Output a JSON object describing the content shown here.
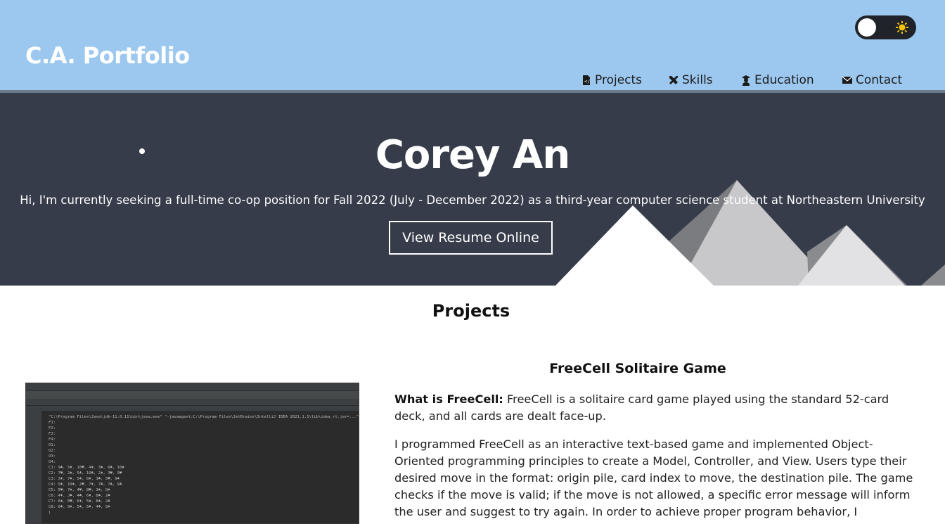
{
  "header": {
    "brand": "C.A. Portfolio",
    "nav": [
      {
        "label": "Projects",
        "icon": "code-file-icon"
      },
      {
        "label": "Skills",
        "icon": "tools-icon"
      },
      {
        "label": "Education",
        "icon": "graduate-icon"
      },
      {
        "label": "Contact",
        "icon": "envelope-icon"
      }
    ],
    "theme_toggle_icon": "sun-icon"
  },
  "hero": {
    "name": "Corey An",
    "tagline": "Hi, I'm currently seeking a full-time co-op position for Fall 2022 (July - December 2022) as a third-year computer science student at Northeastern University",
    "resume_button": "View Resume Online"
  },
  "projects": {
    "section_title": "Projects",
    "items": [
      {
        "title": "FreeCell Solitaire Game",
        "label": "What is FreeCell:",
        "intro": " FreeCell is a solitaire card game played using the standard 52-card deck, and all cards are dealt face-up.",
        "description": "I programmed FreeCell as an interactive text-based game and implemented Object-Oriented programming principles to create a Model, Controller, and View. Users type their desired move in the format: origin pile, card index to move, the destination pile. The game checks if the move is valid; if the move is not allowed, a specific error message will inform the user and suggest to try again. In order to achieve proper program behavior, I performed",
        "screenshot_console": "\"C:\\Program Files\\Java\\jdk-11.0.11\\bin\\java.exe\" \"-javaagent:C:\\Program Files\\JetBrains\\IntelliJ IDEA 2021.1.1\\lib\\idea_rt.jar=...\"\nF1:\nF2:\nF3:\nF4:\nO1:\nO2:\nO3:\nO4:\nC1: 9♣, 5♦, 10♥, 4♦, 3♠, 6♣, 10♠\nC2: 7♥, 2♠, 5♣, 10♣, 2♦, 3♥, 9♥\nC3: 3♦, 7♠, 5♠, 8♦, 3♣, 5♥, 9♠\nC4: 9♦, 10♦, 2♥, 7♦, 7♣, 7♣, 9♣\nC5: 5♥, 7♠, 4♥, 8♥, 3♠, Q♦\nC6: 4♦, J♣, 4♣, 6♦, 8♠, 2♣\nC7: 6♠, 6♥, 6♦, 5♠, 8♠, 2♣\nC8: 6♣, 9♦, 5♠, 5♣, 4♣, 9♦\n|"
      }
    ]
  }
}
